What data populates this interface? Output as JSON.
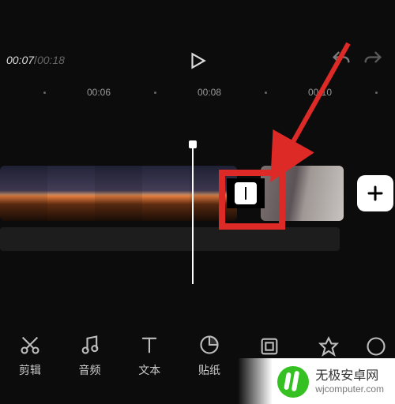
{
  "playback": {
    "current": "00:07",
    "total": "00:18"
  },
  "ruler": {
    "t0": "00:06",
    "t1": "00:08",
    "t2": "00:10"
  },
  "toolbar": {
    "cut": "剪辑",
    "audio": "音频",
    "text": "文本",
    "sticker": "贴纸"
  },
  "watermark": {
    "line1": "无极安卓网",
    "line2": "wjcomputer.com"
  }
}
